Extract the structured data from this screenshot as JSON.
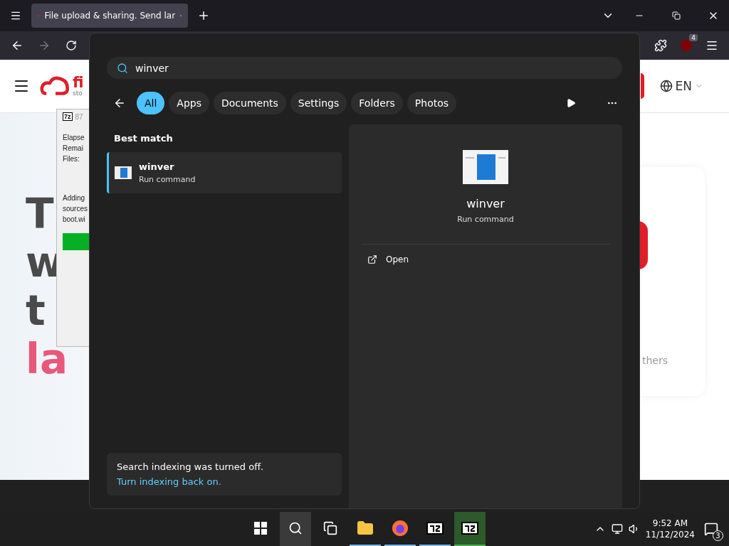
{
  "browser": {
    "tab": {
      "title": "File upload & sharing. Send lar",
      "selected": true
    },
    "extension_badge": "4"
  },
  "page": {
    "logo": {
      "name": "fi",
      "tagline": "sto"
    },
    "language": "EN",
    "hero_lines": [
      {
        "text": "T",
        "kind": "plain"
      },
      {
        "text": "w",
        "kind": "plain"
      },
      {
        "text": "t",
        "kind": "plain"
      },
      {
        "text": "la",
        "kind": "accent"
      }
    ],
    "card": {
      "text": "thers"
    }
  },
  "archive_window": {
    "app_badge": "7z",
    "title": "87",
    "labels": [
      "Elapse",
      "Remai",
      "Files:"
    ],
    "status": "Adding",
    "paths": [
      "sources",
      "boot.wi"
    ],
    "level": 1
  },
  "search": {
    "query": "winver",
    "filters": [
      {
        "label": "All",
        "selected": true
      },
      {
        "label": "Apps",
        "selected": false
      },
      {
        "label": "Documents",
        "selected": false
      },
      {
        "label": "Settings",
        "selected": false
      },
      {
        "label": "Folders",
        "selected": false
      },
      {
        "label": "Photos",
        "selected": false
      }
    ],
    "best_match_heading": "Best match",
    "results": [
      {
        "title": "winver",
        "subtitle": "Run command",
        "selected": true
      }
    ],
    "detail": {
      "title": "winver",
      "subtitle": "Run command",
      "actions": [
        {
          "label": "Open"
        }
      ]
    },
    "notice": {
      "text": "Search indexing was turned off.",
      "link": "Turn indexing back on."
    }
  },
  "taskbar": {
    "items": [
      {
        "kind": "start",
        "running": false,
        "selected": false
      },
      {
        "kind": "search",
        "running": false,
        "selected": true
      },
      {
        "kind": "taskview",
        "running": false,
        "selected": false
      },
      {
        "kind": "explorer",
        "running": true,
        "selected": false
      },
      {
        "kind": "firefox",
        "running": true,
        "selected": false
      },
      {
        "kind": "archiver",
        "running": true,
        "selected": false
      },
      {
        "kind": "archiver",
        "running": true,
        "selected": true
      }
    ],
    "time": "9:52 AM",
    "date": "11/12/2024",
    "notifications": "3"
  }
}
